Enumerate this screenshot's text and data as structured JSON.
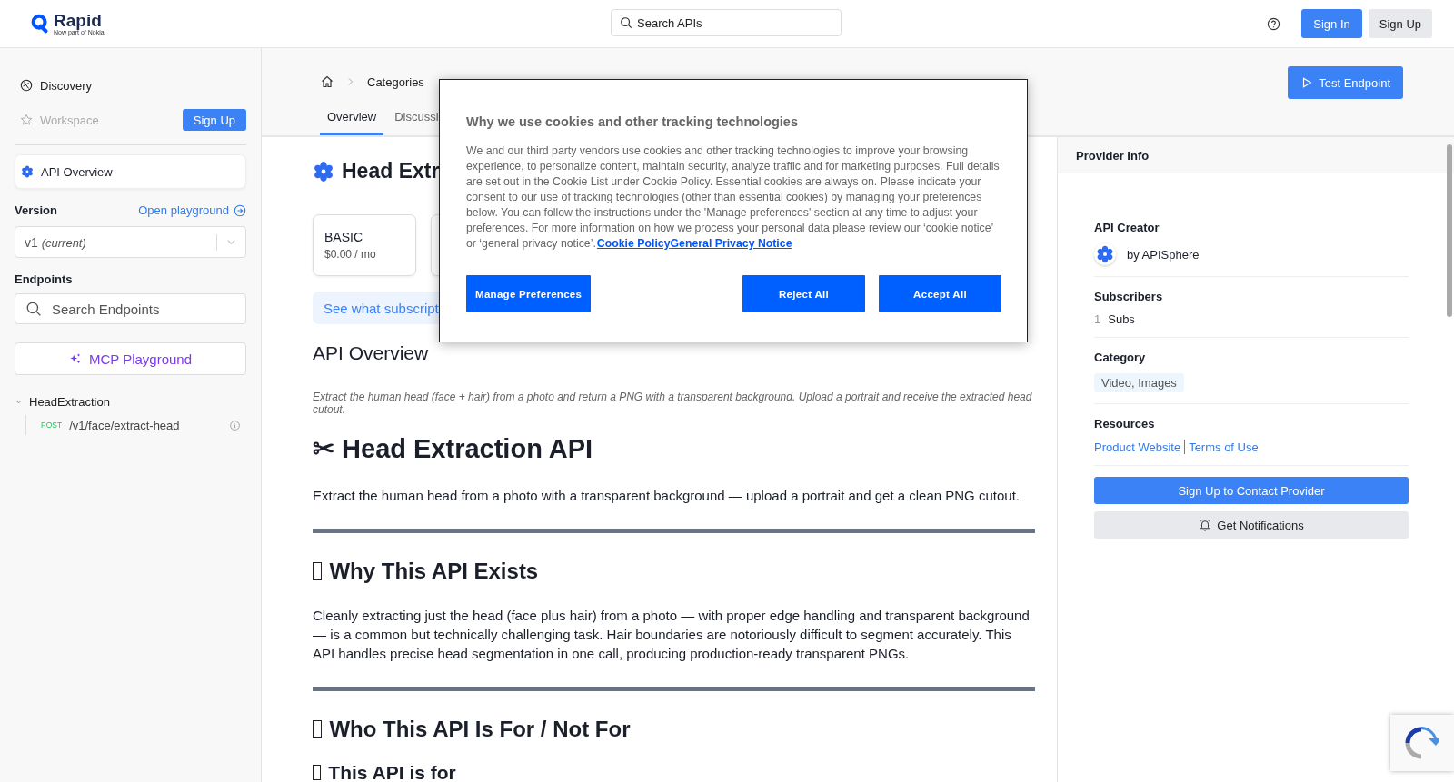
{
  "header": {
    "logo": {
      "name": "Rapid",
      "tagline": "Now part of Nokia"
    },
    "search": {
      "placeholder": "Search APIs"
    },
    "sign_in": "Sign In",
    "sign_up": "Sign Up"
  },
  "sidebar": {
    "nav": [
      {
        "label": "Discovery",
        "disabled": false
      },
      {
        "label": "Workspace",
        "disabled": true
      }
    ],
    "sign_up": "Sign Up",
    "api_overview": {
      "label": "API Overview",
      "selected": true
    },
    "version": {
      "label": "Version",
      "link": "Open playground",
      "value": "v1",
      "note": "(current)"
    },
    "endpoints": {
      "label": "Endpoints",
      "placeholder": "Search Endpoints"
    },
    "mcp_button": "MCP Playground",
    "groups": [
      {
        "name": "HeadExtraction",
        "expanded": true,
        "children": [
          {
            "method": "POST",
            "path": "/v1/face/extract-head"
          }
        ]
      }
    ]
  },
  "main": {
    "breadcrumb": [
      "Categories"
    ],
    "tabs": [
      {
        "label": "Overview",
        "selected": true
      },
      {
        "label": "Discussi",
        "selected": false
      }
    ],
    "test_button": "Test Endpoint",
    "title": "Head Extr",
    "plans": [
      {
        "name": "BASIC",
        "price": "$0.00 / mo"
      }
    ],
    "subscription_link": "See what subscript",
    "overview_heading": "API Overview",
    "summary": "Extract the human head (face + hair) from a photo and return a PNG with a transparent background. Upload a portrait and receive the extracted head cutout.",
    "doc": [
      {
        "kind": "h1",
        "text": "✂ Head Extraction API",
        "missing_glyph": false
      },
      {
        "kind": "p",
        "text": "Extract the human head from a photo with a transparent background — upload a portrait and get a clean PNG cutout."
      },
      {
        "kind": "rule"
      },
      {
        "kind": "h2",
        "text": "Why This API Exists",
        "missing_glyph": true
      },
      {
        "kind": "p",
        "text": "Cleanly extracting just the head (face plus hair) from a photo — with proper edge handling and transparent background — is a common but technically challenging task. Hair boundaries are notoriously difficult to segment accurately. This API handles precise head segmentation in one call, producing production-ready transparent PNGs."
      },
      {
        "kind": "rule"
      },
      {
        "kind": "h2",
        "text": "Who This API Is For / Not For",
        "missing_glyph": true
      },
      {
        "kind": "h3",
        "text": "This API is for",
        "missing_glyph": true
      }
    ]
  },
  "provider": {
    "header": "Provider Info",
    "creator_label": "API Creator",
    "creator": "by APISphere",
    "subscribers_label": "Subscribers",
    "subscribers_count": "1",
    "subscribers_unit": "Subs",
    "category_label": "Category",
    "tags": [
      "Video, Images"
    ],
    "resources_label": "Resources",
    "links": [
      "Product Website",
      "Terms of Use"
    ],
    "contact_button": "Sign Up to Contact Provider",
    "notify_button": "Get Notifications"
  },
  "cookie": {
    "title": "Why we use cookies and other tracking technologies",
    "body": "We and our third party vendors use cookies and other tracking technologies to improve your browsing experience, to personalize content, maintain security, analyze traffic and for marketing purposes. Full details are set out in the Cookie List under Cookie Policy. Essential cookies are always on. Please indicate your consent to our use of tracking technologies (other than essential cookies) by managing your preferences below. You can follow the instructions under the 'Manage preferences' section at any time to adjust your preferences. For more information on how we process your personal data please review our ‘cookie notice’ or ‘general privacy notice’.",
    "links": [
      "Cookie Policy",
      "General Privacy Notice"
    ],
    "manage_button": "Manage Preferences",
    "reject_button": "Reject All",
    "accept_button": "Accept All"
  }
}
